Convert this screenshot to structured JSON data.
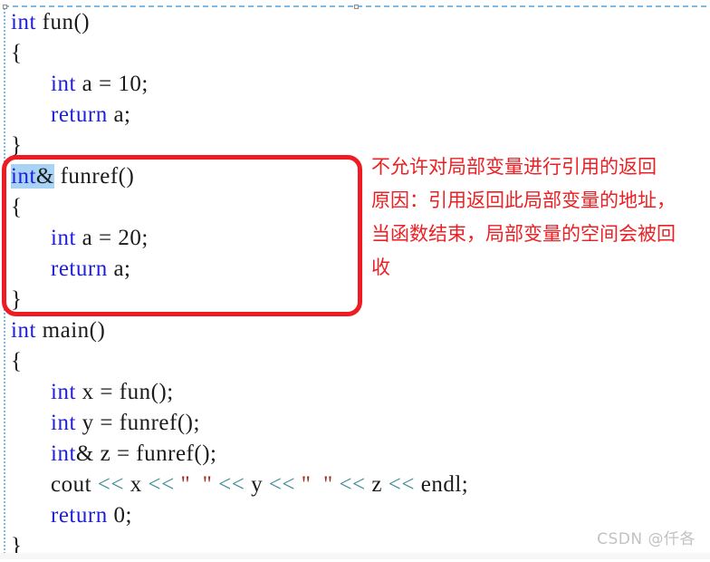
{
  "code": {
    "language": "C++",
    "lines": [
      {
        "id": "l1",
        "indent": 0,
        "tokens": [
          {
            "text": "int",
            "type": "keyword"
          },
          {
            "text": " fun()",
            "type": "plain"
          }
        ]
      },
      {
        "id": "l2",
        "indent": 0,
        "tokens": [
          {
            "text": "{",
            "type": "plain"
          }
        ]
      },
      {
        "id": "l3",
        "indent": 1,
        "tokens": [
          {
            "text": "int",
            "type": "keyword"
          },
          {
            "text": " a = 10;",
            "type": "plain"
          }
        ]
      },
      {
        "id": "l4",
        "indent": 1,
        "tokens": [
          {
            "text": "return",
            "type": "keyword"
          },
          {
            "text": " a;",
            "type": "plain"
          }
        ]
      },
      {
        "id": "l5",
        "indent": 0,
        "tokens": [
          {
            "text": "}",
            "type": "plain"
          }
        ]
      },
      {
        "id": "l6",
        "indent": 0,
        "tokens": [
          {
            "text": "int",
            "type": "keyword-selected"
          },
          {
            "text": "&",
            "type": "plain-selected"
          },
          {
            "text": " funref()",
            "type": "plain"
          }
        ]
      },
      {
        "id": "l7",
        "indent": 0,
        "tokens": [
          {
            "text": "{",
            "type": "plain"
          }
        ]
      },
      {
        "id": "l8",
        "indent": 1,
        "tokens": [
          {
            "text": "int",
            "type": "keyword"
          },
          {
            "text": " a = 20;",
            "type": "plain"
          }
        ]
      },
      {
        "id": "l9",
        "indent": 1,
        "tokens": [
          {
            "text": "return",
            "type": "keyword"
          },
          {
            "text": " a;",
            "type": "plain"
          }
        ]
      },
      {
        "id": "l10",
        "indent": 0,
        "tokens": [
          {
            "text": "}",
            "type": "plain"
          }
        ]
      },
      {
        "id": "l11",
        "indent": 0,
        "tokens": [
          {
            "text": "int",
            "type": "keyword"
          },
          {
            "text": " main()",
            "type": "plain"
          }
        ]
      },
      {
        "id": "l12",
        "indent": 0,
        "tokens": [
          {
            "text": "{",
            "type": "plain"
          }
        ]
      },
      {
        "id": "l13",
        "indent": 1,
        "tokens": [
          {
            "text": "int",
            "type": "keyword"
          },
          {
            "text": " x = fun();",
            "type": "plain"
          }
        ]
      },
      {
        "id": "l14",
        "indent": 1,
        "tokens": [
          {
            "text": "int",
            "type": "keyword"
          },
          {
            "text": " y = funref();",
            "type": "plain"
          }
        ]
      },
      {
        "id": "l15",
        "indent": 1,
        "tokens": [
          {
            "text": "int",
            "type": "keyword"
          },
          {
            "text": "& z = funref();",
            "type": "plain"
          }
        ]
      },
      {
        "id": "l16",
        "indent": 1,
        "tokens": [
          {
            "text": "cout ",
            "type": "plain"
          },
          {
            "text": "<<",
            "type": "operator"
          },
          {
            "text": " x ",
            "type": "plain"
          },
          {
            "text": "<<",
            "type": "operator"
          },
          {
            "text": " ",
            "type": "plain"
          },
          {
            "text": "\"  \"",
            "type": "string"
          },
          {
            "text": " ",
            "type": "plain"
          },
          {
            "text": "<<",
            "type": "operator"
          },
          {
            "text": " y ",
            "type": "plain"
          },
          {
            "text": "<<",
            "type": "operator"
          },
          {
            "text": " ",
            "type": "plain"
          },
          {
            "text": "\"  \"",
            "type": "string"
          },
          {
            "text": " ",
            "type": "plain"
          },
          {
            "text": "<<",
            "type": "operator"
          },
          {
            "text": " z ",
            "type": "plain"
          },
          {
            "text": "<<",
            "type": "operator"
          },
          {
            "text": " endl;",
            "type": "plain"
          }
        ]
      },
      {
        "id": "l17",
        "indent": 1,
        "tokens": [
          {
            "text": "return",
            "type": "keyword"
          },
          {
            "text": " 0;",
            "type": "plain"
          }
        ]
      },
      {
        "id": "l18",
        "indent": 0,
        "tokens": [
          {
            "text": "}",
            "type": "plain"
          }
        ]
      }
    ]
  },
  "annotation": {
    "color": "#ec2024",
    "lines": [
      "不允许对局部变量进行引用的返回",
      "原因：引用返回此局部变量的地址，",
      "当函数结束，局部变量的空间会被回",
      "收"
    ]
  },
  "highlight_box": {
    "color": "#ee1c22",
    "label": "funref-function-callout"
  },
  "colors": {
    "keyword": "#2020d8",
    "operator": "#3b8a96",
    "string": "#a02c1e",
    "plain": "#1a1a1a",
    "selection": "#a8d3f5",
    "frame_dash": "#7fb8e0",
    "watermark": "#c2c2c2"
  },
  "watermark": {
    "text": "CSDN @仟各"
  }
}
